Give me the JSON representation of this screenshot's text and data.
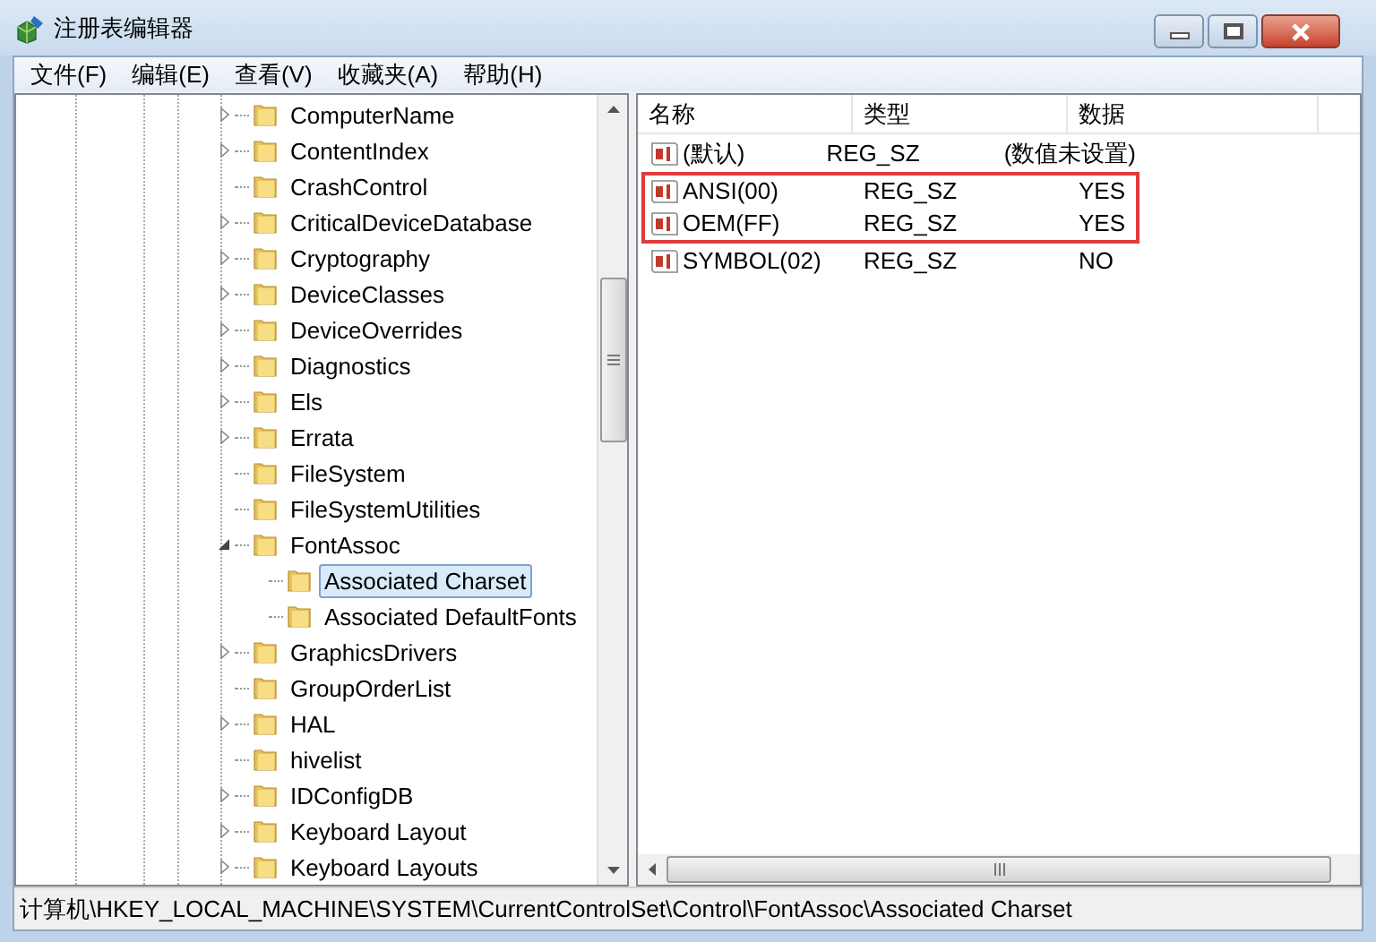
{
  "window": {
    "title": "注册表编辑器"
  },
  "menu": [
    "文件(F)",
    "编辑(E)",
    "查看(V)",
    "收藏夹(A)",
    "帮助(H)"
  ],
  "tree": [
    {
      "label": "ComputerName",
      "kind": "branch",
      "expanded": false,
      "selected": false
    },
    {
      "label": "ContentIndex",
      "kind": "branch",
      "expanded": false,
      "selected": false
    },
    {
      "label": "CrashControl",
      "kind": "leaf",
      "expanded": false,
      "selected": false
    },
    {
      "label": "CriticalDeviceDatabase",
      "kind": "branch",
      "expanded": false,
      "selected": false
    },
    {
      "label": "Cryptography",
      "kind": "branch",
      "expanded": false,
      "selected": false
    },
    {
      "label": "DeviceClasses",
      "kind": "branch",
      "expanded": false,
      "selected": false
    },
    {
      "label": "DeviceOverrides",
      "kind": "branch",
      "expanded": false,
      "selected": false
    },
    {
      "label": "Diagnostics",
      "kind": "branch",
      "expanded": false,
      "selected": false
    },
    {
      "label": "Els",
      "kind": "branch",
      "expanded": false,
      "selected": false
    },
    {
      "label": "Errata",
      "kind": "branch",
      "expanded": false,
      "selected": false
    },
    {
      "label": "FileSystem",
      "kind": "leaf",
      "expanded": false,
      "selected": false
    },
    {
      "label": "FileSystemUtilities",
      "kind": "leaf",
      "expanded": false,
      "selected": false
    },
    {
      "label": "FontAssoc",
      "kind": "branch",
      "expanded": true,
      "selected": false,
      "children": [
        {
          "label": "Associated Charset",
          "kind": "leaf",
          "expanded": false,
          "selected": true
        },
        {
          "label": "Associated DefaultFonts",
          "kind": "leaf",
          "expanded": false,
          "selected": false
        }
      ]
    },
    {
      "label": "GraphicsDrivers",
      "kind": "branch",
      "expanded": false,
      "selected": false
    },
    {
      "label": "GroupOrderList",
      "kind": "leaf",
      "expanded": false,
      "selected": false
    },
    {
      "label": "HAL",
      "kind": "branch",
      "expanded": false,
      "selected": false
    },
    {
      "label": "hivelist",
      "kind": "leaf",
      "expanded": false,
      "selected": false
    },
    {
      "label": "IDConfigDB",
      "kind": "branch",
      "expanded": false,
      "selected": false
    },
    {
      "label": "Keyboard Layout",
      "kind": "branch",
      "expanded": false,
      "selected": false
    },
    {
      "label": "Keyboard Layouts",
      "kind": "branch",
      "expanded": false,
      "selected": false
    }
  ],
  "table": {
    "columns": [
      "名称",
      "类型",
      "数据"
    ],
    "rows": [
      {
        "name": "(默认)",
        "type": "REG_SZ",
        "data": "(数值未设置)",
        "highlighted": false
      },
      {
        "name": "ANSI(00)",
        "type": "REG_SZ",
        "data": "YES",
        "highlighted": true
      },
      {
        "name": "OEM(FF)",
        "type": "REG_SZ",
        "data": "YES",
        "highlighted": true
      },
      {
        "name": "SYMBOL(02)",
        "type": "REG_SZ",
        "data": "NO",
        "highlighted": false
      }
    ]
  },
  "status_bar": "计算机\\HKEY_LOCAL_MACHINE\\SYSTEM\\CurrentControlSet\\Control\\FontAssoc\\Associated Charset"
}
